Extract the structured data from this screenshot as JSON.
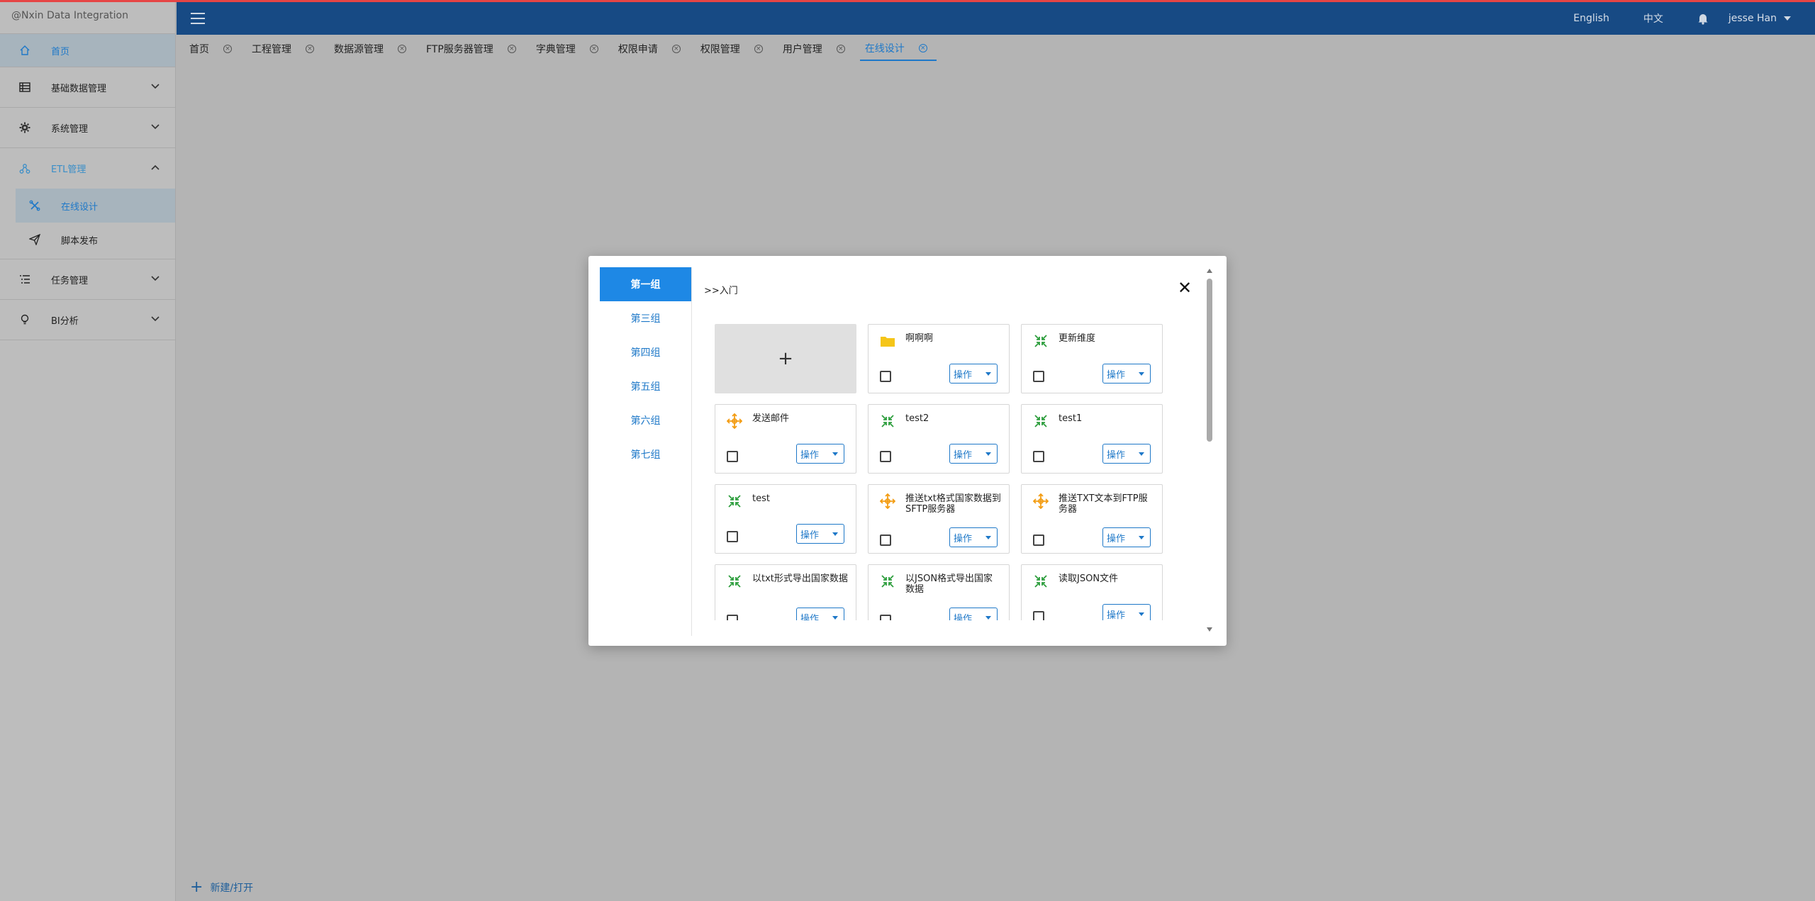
{
  "brand": "@Nxin Data Integration",
  "sidebar": {
    "home": "首页",
    "items": [
      {
        "label": "基础数据管理"
      },
      {
        "label": "系统管理"
      },
      {
        "label": "ETL管理"
      },
      {
        "label": "任务管理"
      },
      {
        "label": "BI分析"
      }
    ],
    "etl_sub": [
      {
        "label": "在线设计"
      },
      {
        "label": "脚本发布"
      }
    ]
  },
  "topbar": {
    "lang_en": "English",
    "lang_zh": "中文",
    "user": "jesse Han"
  },
  "tabs": [
    "首页",
    "工程管理",
    "数据源管理",
    "FTP服务器管理",
    "字典管理",
    "权限申请",
    "权限管理",
    "用户管理",
    "在线设计"
  ],
  "footer": {
    "new_open": "新建/打开"
  },
  "dialog": {
    "groups": [
      "第一组",
      "第三组",
      "第四组",
      "第五组",
      "第六组",
      "第七组"
    ],
    "breadcrumb": ">>入门",
    "add_symbol": "+",
    "op_label": "操作",
    "cards": [
      {
        "name": "啊啊啊",
        "icon": "folder-icon"
      },
      {
        "name": "更新维度",
        "icon": "transform-icon"
      },
      {
        "name": "发送邮件",
        "icon": "job-icon"
      },
      {
        "name": "test2",
        "icon": "transform-icon"
      },
      {
        "name": "test1",
        "icon": "transform-icon"
      },
      {
        "name": "test",
        "icon": "transform-icon"
      },
      {
        "name": "推送txt格式国家数据到SFTP服务器",
        "icon": "job-icon"
      },
      {
        "name": "推送TXT文本到FTP服务器",
        "icon": "job-icon"
      },
      {
        "name": "以txt形式导出国家数据",
        "icon": "transform-icon"
      },
      {
        "name": "以JSON格式导出国家数据",
        "icon": "transform-icon"
      },
      {
        "name": "读取JSON文件",
        "icon": "transform-icon"
      }
    ]
  },
  "colors": {
    "topbar": "#174a84",
    "accent": "#1e88e5",
    "transform_icon": "#2e9e3e",
    "job_icon": "#f39c12",
    "folder_icon": "#f5c518"
  }
}
